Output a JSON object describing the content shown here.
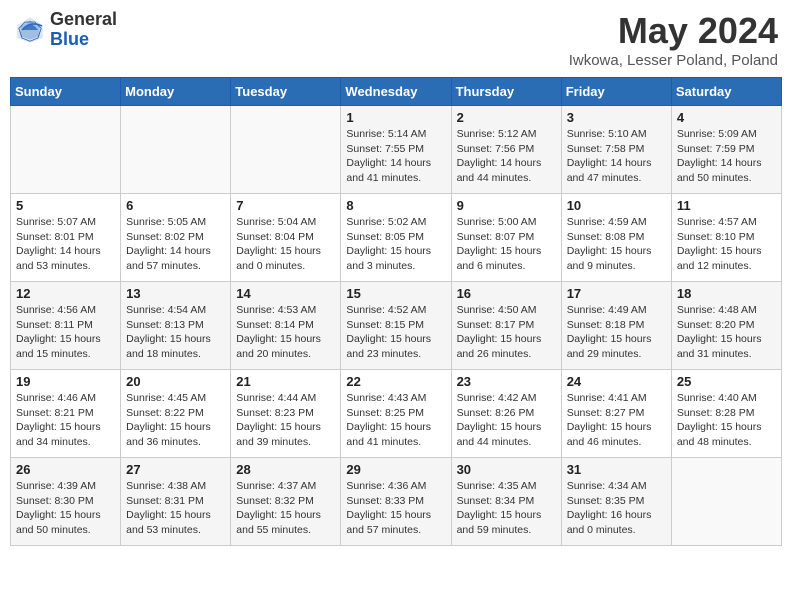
{
  "header": {
    "logo_general": "General",
    "logo_blue": "Blue",
    "month_title": "May 2024",
    "location": "Iwkowa, Lesser Poland, Poland"
  },
  "weekdays": [
    "Sunday",
    "Monday",
    "Tuesday",
    "Wednesday",
    "Thursday",
    "Friday",
    "Saturday"
  ],
  "weeks": [
    [
      {
        "day": "",
        "info": ""
      },
      {
        "day": "",
        "info": ""
      },
      {
        "day": "",
        "info": ""
      },
      {
        "day": "1",
        "info": "Sunrise: 5:14 AM\nSunset: 7:55 PM\nDaylight: 14 hours\nand 41 minutes."
      },
      {
        "day": "2",
        "info": "Sunrise: 5:12 AM\nSunset: 7:56 PM\nDaylight: 14 hours\nand 44 minutes."
      },
      {
        "day": "3",
        "info": "Sunrise: 5:10 AM\nSunset: 7:58 PM\nDaylight: 14 hours\nand 47 minutes."
      },
      {
        "day": "4",
        "info": "Sunrise: 5:09 AM\nSunset: 7:59 PM\nDaylight: 14 hours\nand 50 minutes."
      }
    ],
    [
      {
        "day": "5",
        "info": "Sunrise: 5:07 AM\nSunset: 8:01 PM\nDaylight: 14 hours\nand 53 minutes."
      },
      {
        "day": "6",
        "info": "Sunrise: 5:05 AM\nSunset: 8:02 PM\nDaylight: 14 hours\nand 57 minutes."
      },
      {
        "day": "7",
        "info": "Sunrise: 5:04 AM\nSunset: 8:04 PM\nDaylight: 15 hours\nand 0 minutes."
      },
      {
        "day": "8",
        "info": "Sunrise: 5:02 AM\nSunset: 8:05 PM\nDaylight: 15 hours\nand 3 minutes."
      },
      {
        "day": "9",
        "info": "Sunrise: 5:00 AM\nSunset: 8:07 PM\nDaylight: 15 hours\nand 6 minutes."
      },
      {
        "day": "10",
        "info": "Sunrise: 4:59 AM\nSunset: 8:08 PM\nDaylight: 15 hours\nand 9 minutes."
      },
      {
        "day": "11",
        "info": "Sunrise: 4:57 AM\nSunset: 8:10 PM\nDaylight: 15 hours\nand 12 minutes."
      }
    ],
    [
      {
        "day": "12",
        "info": "Sunrise: 4:56 AM\nSunset: 8:11 PM\nDaylight: 15 hours\nand 15 minutes."
      },
      {
        "day": "13",
        "info": "Sunrise: 4:54 AM\nSunset: 8:13 PM\nDaylight: 15 hours\nand 18 minutes."
      },
      {
        "day": "14",
        "info": "Sunrise: 4:53 AM\nSunset: 8:14 PM\nDaylight: 15 hours\nand 20 minutes."
      },
      {
        "day": "15",
        "info": "Sunrise: 4:52 AM\nSunset: 8:15 PM\nDaylight: 15 hours\nand 23 minutes."
      },
      {
        "day": "16",
        "info": "Sunrise: 4:50 AM\nSunset: 8:17 PM\nDaylight: 15 hours\nand 26 minutes."
      },
      {
        "day": "17",
        "info": "Sunrise: 4:49 AM\nSunset: 8:18 PM\nDaylight: 15 hours\nand 29 minutes."
      },
      {
        "day": "18",
        "info": "Sunrise: 4:48 AM\nSunset: 8:20 PM\nDaylight: 15 hours\nand 31 minutes."
      }
    ],
    [
      {
        "day": "19",
        "info": "Sunrise: 4:46 AM\nSunset: 8:21 PM\nDaylight: 15 hours\nand 34 minutes."
      },
      {
        "day": "20",
        "info": "Sunrise: 4:45 AM\nSunset: 8:22 PM\nDaylight: 15 hours\nand 36 minutes."
      },
      {
        "day": "21",
        "info": "Sunrise: 4:44 AM\nSunset: 8:23 PM\nDaylight: 15 hours\nand 39 minutes."
      },
      {
        "day": "22",
        "info": "Sunrise: 4:43 AM\nSunset: 8:25 PM\nDaylight: 15 hours\nand 41 minutes."
      },
      {
        "day": "23",
        "info": "Sunrise: 4:42 AM\nSunset: 8:26 PM\nDaylight: 15 hours\nand 44 minutes."
      },
      {
        "day": "24",
        "info": "Sunrise: 4:41 AM\nSunset: 8:27 PM\nDaylight: 15 hours\nand 46 minutes."
      },
      {
        "day": "25",
        "info": "Sunrise: 4:40 AM\nSunset: 8:28 PM\nDaylight: 15 hours\nand 48 minutes."
      }
    ],
    [
      {
        "day": "26",
        "info": "Sunrise: 4:39 AM\nSunset: 8:30 PM\nDaylight: 15 hours\nand 50 minutes."
      },
      {
        "day": "27",
        "info": "Sunrise: 4:38 AM\nSunset: 8:31 PM\nDaylight: 15 hours\nand 53 minutes."
      },
      {
        "day": "28",
        "info": "Sunrise: 4:37 AM\nSunset: 8:32 PM\nDaylight: 15 hours\nand 55 minutes."
      },
      {
        "day": "29",
        "info": "Sunrise: 4:36 AM\nSunset: 8:33 PM\nDaylight: 15 hours\nand 57 minutes."
      },
      {
        "day": "30",
        "info": "Sunrise: 4:35 AM\nSunset: 8:34 PM\nDaylight: 15 hours\nand 59 minutes."
      },
      {
        "day": "31",
        "info": "Sunrise: 4:34 AM\nSunset: 8:35 PM\nDaylight: 16 hours\nand 0 minutes."
      },
      {
        "day": "",
        "info": ""
      }
    ]
  ]
}
